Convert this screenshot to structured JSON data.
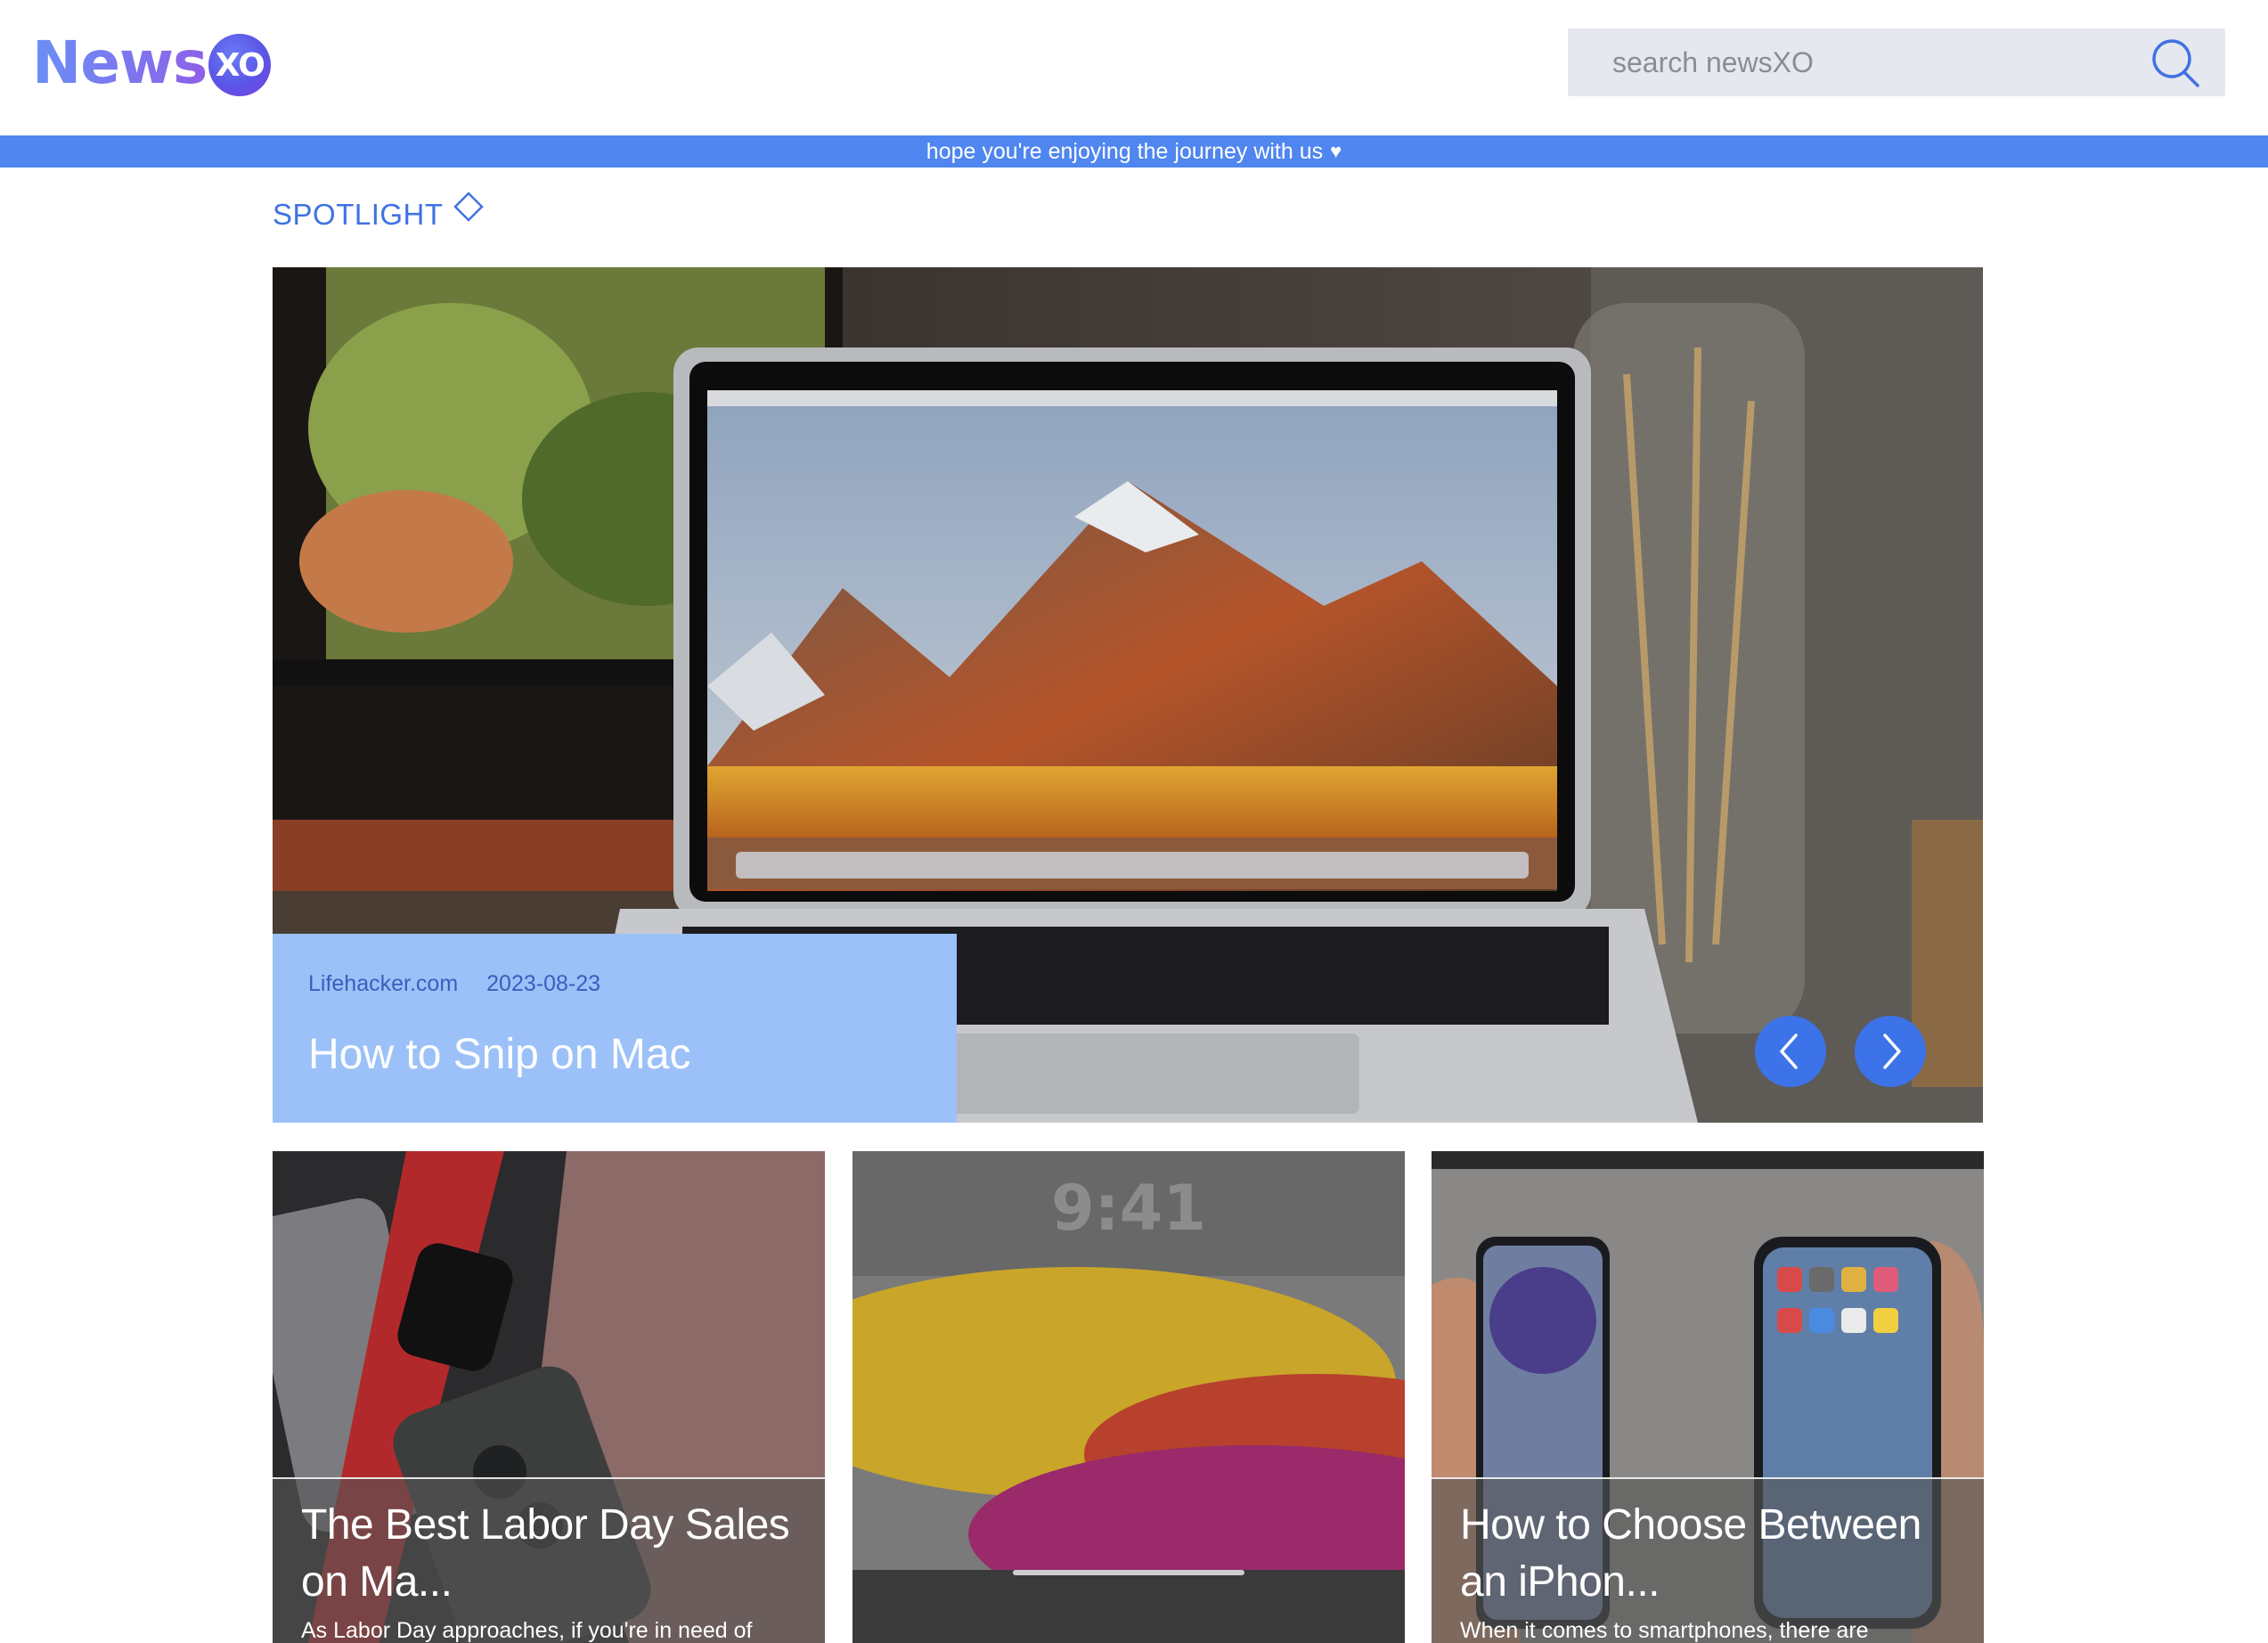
{
  "header": {
    "logo": {
      "text": "News",
      "badge": "XO"
    },
    "search": {
      "placeholder": "search newsXO",
      "icon": "search-icon"
    }
  },
  "banner": {
    "text": "hope you're enjoying the journey with us",
    "heart": "♥"
  },
  "spotlight": {
    "title": "SPOTLIGHT",
    "icon": "diamond-icon",
    "hero": {
      "source": "Lifehacker.com",
      "date": "2023-08-23",
      "headline": "How to Snip on Mac",
      "prev_icon": "chevron-left-icon",
      "next_icon": "chevron-right-icon"
    }
  },
  "cards": [
    {
      "title": "The Best Labor Day Sales on Ma...",
      "excerpt": "As Labor Day approaches, if you're in need of"
    },
    {
      "title": "",
      "excerpt": ""
    },
    {
      "title": "How to Choose Between an iPhon...",
      "excerpt": "When it comes to smartphones, there are"
    }
  ],
  "colors": {
    "accent": "#4f86ef",
    "caption_bg": "#9cc1f8",
    "nav_button": "#3d73e8"
  }
}
